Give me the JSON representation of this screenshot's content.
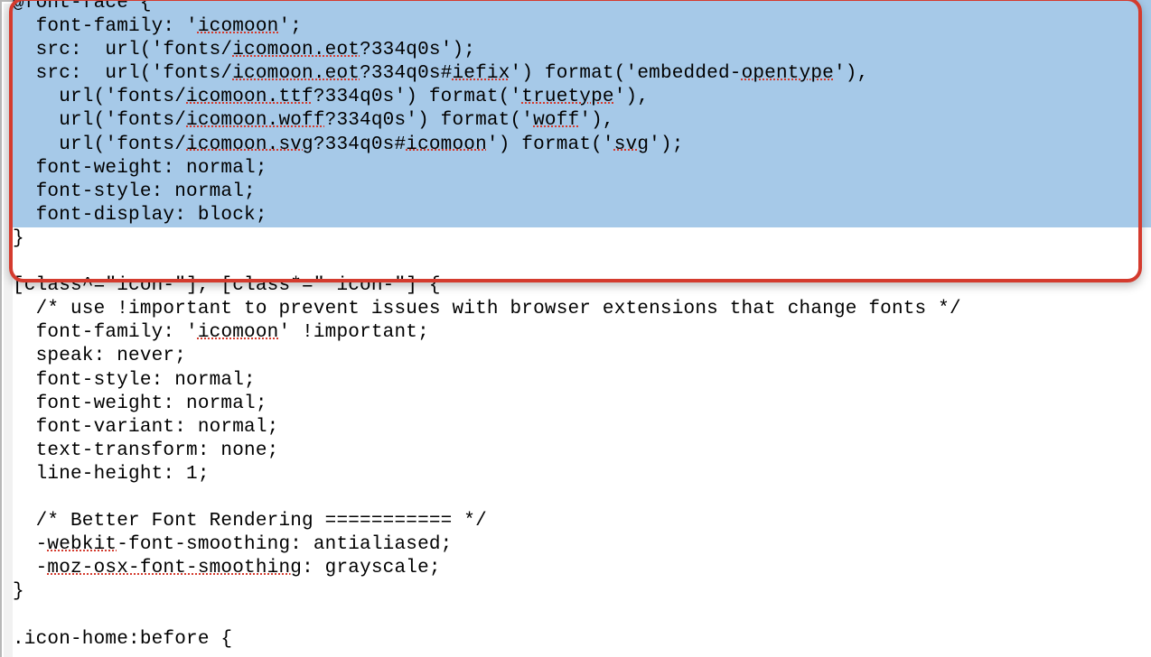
{
  "block1": {
    "l1_a": "@font-face {",
    "l2_a": "  font-family: '",
    "l2_s1": "icomoon",
    "l2_b": "';",
    "l3_a": "  src:  url('fonts/",
    "l3_s1": "icomoon.eot",
    "l3_b": "?334q0s');",
    "l4_a": "  src:  url('fonts/",
    "l4_s1": "icomoon.eot",
    "l4_b": "?334q0s#",
    "l4_s2": "iefix",
    "l4_c": "') format('embedded-",
    "l4_s3": "opentype",
    "l4_d": "'),",
    "l5_a": "    url('fonts/",
    "l5_s1": "icomoon.ttf",
    "l5_b": "?334q0s') format('",
    "l5_s2": "truetype",
    "l5_c": "'),",
    "l6_a": "    url('fonts/",
    "l6_s1": "icomoon.woff",
    "l6_b": "?334q0s') format('",
    "l6_s2": "woff",
    "l6_c": "'),",
    "l7_a": "    url('fonts/",
    "l7_s1": "icomoon.svg",
    "l7_b": "?334q0s#",
    "l7_s2": "icomoon",
    "l7_c": "') format('",
    "l7_s3": "svg",
    "l7_d": "');",
    "l8_a": "  font-weight: normal;",
    "l9_a": "  font-style: normal;",
    "l10_a": "  font-display: block;",
    "l11_a": "}"
  },
  "block2": {
    "l1_a": "[class^=\"icon-\"], [class*=\" icon-\"] {",
    "l2_a": "  /* use !important to prevent issues with browser extensions that change fonts */",
    "l3_a": "  font-family: '",
    "l3_s1": "icomoon",
    "l3_b": "' !important;",
    "l4_a": "  speak: never;",
    "l5_a": "  font-style: normal;",
    "l6_a": "  font-weight: normal;",
    "l7_a": "  font-variant: normal;",
    "l8_a": "  text-transform: none;",
    "l9_a": "  line-height: 1;",
    "l11_a": "  /* Better Font Rendering =========== */",
    "l12_a": "  -",
    "l12_s1": "webkit",
    "l12_b": "-font-smoothing: antialiased;",
    "l13_a": "  -",
    "l13_s1": "moz-osx-font-smoothing",
    "l13_b": ": grayscale;",
    "l14_a": "}"
  },
  "block3": {
    "l1_a": ".icon-home:before {"
  }
}
